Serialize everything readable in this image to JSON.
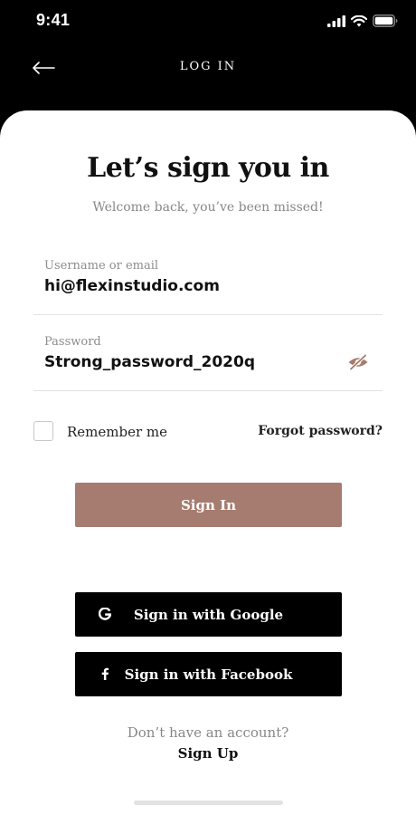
{
  "status_bar": {
    "time": "9:41",
    "icons": [
      "signal-icon",
      "wifi-icon",
      "battery-icon"
    ]
  },
  "header": {
    "title": "LOG IN",
    "back_icon": "back-arrow-icon"
  },
  "main": {
    "title": "Let’s sign you in",
    "subtitle": "Welcome back, you’ve been missed!"
  },
  "form": {
    "username": {
      "label": "Username or email",
      "value": "hi@flexinstudio.com"
    },
    "password": {
      "label": "Password",
      "value": "Strong_password_2020q",
      "toggle_icon": "eye-off-icon"
    },
    "remember": {
      "label": "Remember me",
      "checked": false
    },
    "forgot_label": "Forgot password?",
    "sign_in_label": "Sign In"
  },
  "social": {
    "google_label": "Sign in with Google",
    "google_icon": "google-icon",
    "facebook_label": "Sign in with Facebook",
    "facebook_icon": "facebook-icon"
  },
  "footer": {
    "prompt": "Don’t have an account?",
    "signup_label": "Sign Up"
  },
  "colors": {
    "primary": "#a57c6f",
    "dark": "#000000",
    "background": "#ffffff",
    "muted_text": "#888888"
  }
}
